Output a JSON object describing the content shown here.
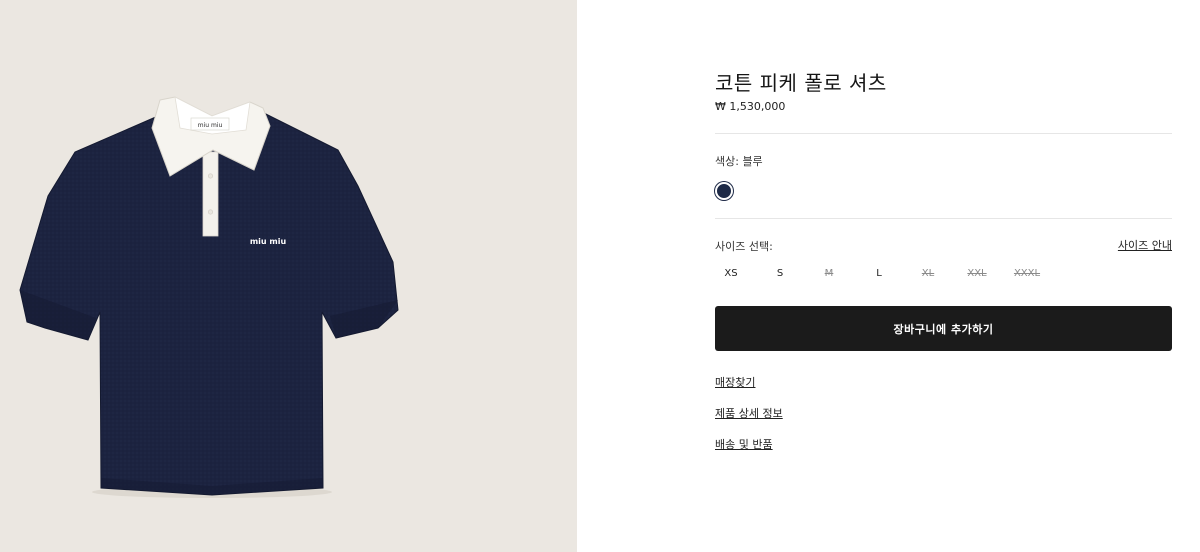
{
  "product": {
    "title": "코튼 피케 폴로 셔츠",
    "price": "₩ 1,530,000",
    "image_alt": "navy polo shirt with white collar",
    "logo_text": "miu miu",
    "collar_label": "miu miu"
  },
  "color": {
    "label": "색상: 블루",
    "swatch": "#1e2a47"
  },
  "size": {
    "label": "사이즈 선택:",
    "guide_link": "사이즈 안내",
    "options": [
      {
        "label": "XS",
        "available": true
      },
      {
        "label": "S",
        "available": true
      },
      {
        "label": "M",
        "available": false
      },
      {
        "label": "L",
        "available": true
      },
      {
        "label": "XL",
        "available": false
      },
      {
        "label": "XXL",
        "available": false
      },
      {
        "label": "XXXL",
        "available": false
      }
    ]
  },
  "actions": {
    "add_to_cart": "장바구니에 추가하기"
  },
  "links": {
    "find_store": "매장찾기",
    "product_details": "제품 상세 정보",
    "shipping_returns": "배송 및 반품"
  },
  "colors": {
    "background": "#ebe7e1",
    "shirt": "#1c2340",
    "button": "#1b1b1b"
  }
}
